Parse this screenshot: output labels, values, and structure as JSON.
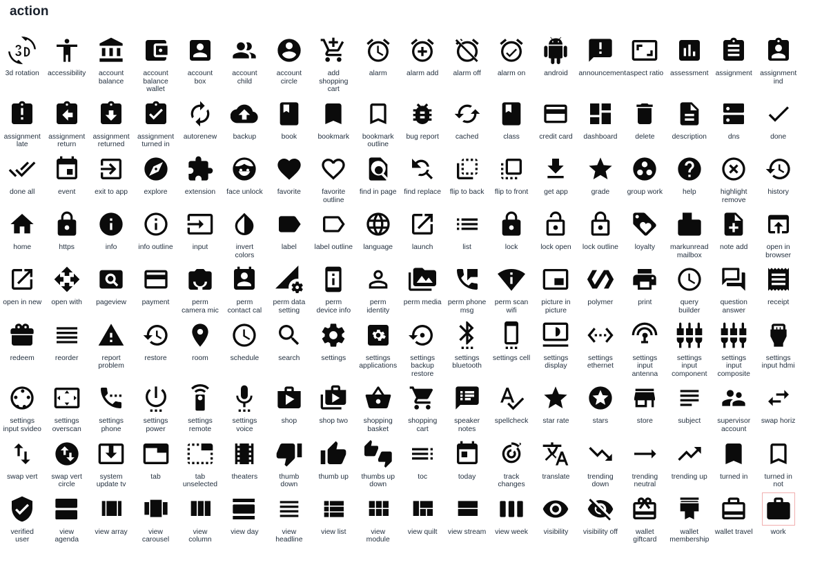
{
  "page": {
    "title": "action"
  },
  "theme": {
    "background": "#ffffff",
    "icon_color": "#0b0b0b",
    "label_color": "#23303f",
    "title_color": "#18202b",
    "highlight_outline": "#f0aaaa"
  },
  "grid": {
    "columns": 18,
    "rows": 8,
    "total_icons": 144
  },
  "icons": [
    {
      "label": "3d rotation",
      "glyph": "3d-rotation-icon"
    },
    {
      "label": "accessibility",
      "glyph": "accessibility-icon"
    },
    {
      "label": "account\nbalance",
      "glyph": "account-balance-icon"
    },
    {
      "label": "account\nbalance\nwallet",
      "glyph": "account-balance-wallet-icon"
    },
    {
      "label": "account\nbox",
      "glyph": "account-box-icon"
    },
    {
      "label": "account\nchild",
      "glyph": "account-child-icon"
    },
    {
      "label": "account\ncircle",
      "glyph": "account-circle-icon"
    },
    {
      "label": "add\nshopping\ncart",
      "glyph": "add-shopping-cart-icon"
    },
    {
      "label": "alarm",
      "glyph": "alarm-icon"
    },
    {
      "label": "alarm add",
      "glyph": "alarm-add-icon"
    },
    {
      "label": "alarm off",
      "glyph": "alarm-off-icon"
    },
    {
      "label": "alarm on",
      "glyph": "alarm-on-icon"
    },
    {
      "label": "android",
      "glyph": "android-icon"
    },
    {
      "label": "announcement",
      "glyph": "announcement-icon"
    },
    {
      "label": "aspect ratio",
      "glyph": "aspect-ratio-icon"
    },
    {
      "label": "assessment",
      "glyph": "assessment-icon"
    },
    {
      "label": "assignment",
      "glyph": "assignment-icon"
    },
    {
      "label": "assignment\nind",
      "glyph": "assignment-ind-icon"
    },
    {
      "label": "assignment\nlate",
      "glyph": "assignment-late-icon"
    },
    {
      "label": "assignment\nreturn",
      "glyph": "assignment-return-icon"
    },
    {
      "label": "assignment\nreturned",
      "glyph": "assignment-returned-icon"
    },
    {
      "label": "assignment\nturned in",
      "glyph": "assignment-turned-in-icon"
    },
    {
      "label": "autorenew",
      "glyph": "autorenew-icon"
    },
    {
      "label": "backup",
      "glyph": "backup-icon"
    },
    {
      "label": "book",
      "glyph": "book-icon"
    },
    {
      "label": "bookmark",
      "glyph": "bookmark-icon"
    },
    {
      "label": "bookmark\noutline",
      "glyph": "bookmark-outline-icon"
    },
    {
      "label": "bug report",
      "glyph": "bug-report-icon"
    },
    {
      "label": "cached",
      "glyph": "cached-icon"
    },
    {
      "label": "class",
      "glyph": "class-icon"
    },
    {
      "label": "credit card",
      "glyph": "credit-card-icon"
    },
    {
      "label": "dashboard",
      "glyph": "dashboard-icon"
    },
    {
      "label": "delete",
      "glyph": "delete-icon"
    },
    {
      "label": "description",
      "glyph": "description-icon"
    },
    {
      "label": "dns",
      "glyph": "dns-icon"
    },
    {
      "label": "done",
      "glyph": "done-icon"
    },
    {
      "label": "done all",
      "glyph": "done-all-icon"
    },
    {
      "label": "event",
      "glyph": "event-icon"
    },
    {
      "label": "exit to app",
      "glyph": "exit-to-app-icon"
    },
    {
      "label": "explore",
      "glyph": "explore-icon"
    },
    {
      "label": "extension",
      "glyph": "extension-icon"
    },
    {
      "label": "face unlock",
      "glyph": "face-unlock-icon"
    },
    {
      "label": "favorite",
      "glyph": "favorite-icon"
    },
    {
      "label": "favorite\noutline",
      "glyph": "favorite-outline-icon"
    },
    {
      "label": "find in page",
      "glyph": "find-in-page-icon"
    },
    {
      "label": "find replace",
      "glyph": "find-replace-icon"
    },
    {
      "label": "flip to back",
      "glyph": "flip-to-back-icon"
    },
    {
      "label": "flip to front",
      "glyph": "flip-to-front-icon"
    },
    {
      "label": "get app",
      "glyph": "get-app-icon"
    },
    {
      "label": "grade",
      "glyph": "grade-icon"
    },
    {
      "label": "group work",
      "glyph": "group-work-icon"
    },
    {
      "label": "help",
      "glyph": "help-icon"
    },
    {
      "label": "highlight\nremove",
      "glyph": "highlight-remove-icon"
    },
    {
      "label": "history",
      "glyph": "history-icon"
    },
    {
      "label": "home",
      "glyph": "home-icon"
    },
    {
      "label": "https",
      "glyph": "https-icon"
    },
    {
      "label": "info",
      "glyph": "info-icon"
    },
    {
      "label": "info outline",
      "glyph": "info-outline-icon"
    },
    {
      "label": "input",
      "glyph": "input-icon"
    },
    {
      "label": "invert\ncolors",
      "glyph": "invert-colors-icon"
    },
    {
      "label": "label",
      "glyph": "label-icon"
    },
    {
      "label": "label outline",
      "glyph": "label-outline-icon"
    },
    {
      "label": "language",
      "glyph": "language-icon"
    },
    {
      "label": "launch",
      "glyph": "launch-icon"
    },
    {
      "label": "list",
      "glyph": "list-icon"
    },
    {
      "label": "lock",
      "glyph": "lock-icon"
    },
    {
      "label": "lock open",
      "glyph": "lock-open-icon"
    },
    {
      "label": "lock outline",
      "glyph": "lock-outline-icon"
    },
    {
      "label": "loyalty",
      "glyph": "loyalty-icon"
    },
    {
      "label": "markunread\nmailbox",
      "glyph": "markunread-mailbox-icon"
    },
    {
      "label": "note add",
      "glyph": "note-add-icon"
    },
    {
      "label": "open in\nbrowser",
      "glyph": "open-in-browser-icon"
    },
    {
      "label": "open in new",
      "glyph": "open-in-new-icon"
    },
    {
      "label": "open with",
      "glyph": "open-with-icon"
    },
    {
      "label": "pageview",
      "glyph": "pageview-icon"
    },
    {
      "label": "payment",
      "glyph": "payment-icon"
    },
    {
      "label": "perm\ncamera mic",
      "glyph": "perm-camera-mic-icon"
    },
    {
      "label": "perm\ncontact cal",
      "glyph": "perm-contact-cal-icon"
    },
    {
      "label": "perm data\nsetting",
      "glyph": "perm-data-setting-icon"
    },
    {
      "label": "perm\ndevice info",
      "glyph": "perm-device-info-icon"
    },
    {
      "label": "perm\nidentity",
      "glyph": "perm-identity-icon"
    },
    {
      "label": "perm media",
      "glyph": "perm-media-icon"
    },
    {
      "label": "perm phone\nmsg",
      "glyph": "perm-phone-msg-icon"
    },
    {
      "label": "perm scan\nwifi",
      "glyph": "perm-scan-wifi-icon"
    },
    {
      "label": "picture in\npicture",
      "glyph": "picture-in-picture-icon"
    },
    {
      "label": "polymer",
      "glyph": "polymer-icon"
    },
    {
      "label": "print",
      "glyph": "print-icon"
    },
    {
      "label": "query\nbuilder",
      "glyph": "query-builder-icon"
    },
    {
      "label": "question\nanswer",
      "glyph": "question-answer-icon"
    },
    {
      "label": "receipt",
      "glyph": "receipt-icon"
    },
    {
      "label": "redeem",
      "glyph": "redeem-icon"
    },
    {
      "label": "reorder",
      "glyph": "reorder-icon"
    },
    {
      "label": "report\nproblem",
      "glyph": "report-problem-icon"
    },
    {
      "label": "restore",
      "glyph": "restore-icon"
    },
    {
      "label": "room",
      "glyph": "room-icon"
    },
    {
      "label": "schedule",
      "glyph": "schedule-icon"
    },
    {
      "label": "search",
      "glyph": "search-icon"
    },
    {
      "label": "settings",
      "glyph": "settings-icon"
    },
    {
      "label": "settings\napplications",
      "glyph": "settings-applications-icon"
    },
    {
      "label": "settings\nbackup\nrestore",
      "glyph": "settings-backup-restore-icon"
    },
    {
      "label": "settings\nbluetooth",
      "glyph": "settings-bluetooth-icon"
    },
    {
      "label": "settings cell",
      "glyph": "settings-cell-icon"
    },
    {
      "label": "settings\ndisplay",
      "glyph": "settings-display-icon"
    },
    {
      "label": "settings\nethernet",
      "glyph": "settings-ethernet-icon"
    },
    {
      "label": "settings\ninput\nantenna",
      "glyph": "settings-input-antenna-icon"
    },
    {
      "label": "settings\ninput\ncomponent",
      "glyph": "settings-input-component-icon"
    },
    {
      "label": "settings\ninput\ncomposite",
      "glyph": "settings-input-composite-icon"
    },
    {
      "label": "settings\ninput hdmi",
      "glyph": "settings-input-hdmi-icon"
    },
    {
      "label": "settings\ninput svideo",
      "glyph": "settings-input-svideo-icon"
    },
    {
      "label": "settings\noverscan",
      "glyph": "settings-overscan-icon"
    },
    {
      "label": "settings\nphone",
      "glyph": "settings-phone-icon"
    },
    {
      "label": "settings\npower",
      "glyph": "settings-power-icon"
    },
    {
      "label": "settings\nremote",
      "glyph": "settings-remote-icon"
    },
    {
      "label": "settings\nvoice",
      "glyph": "settings-voice-icon"
    },
    {
      "label": "shop",
      "glyph": "shop-icon"
    },
    {
      "label": "shop two",
      "glyph": "shop-two-icon"
    },
    {
      "label": "shopping\nbasket",
      "glyph": "shopping-basket-icon"
    },
    {
      "label": "shopping\ncart",
      "glyph": "shopping-cart-icon"
    },
    {
      "label": "speaker\nnotes",
      "glyph": "speaker-notes-icon"
    },
    {
      "label": "spellcheck",
      "glyph": "spellcheck-icon"
    },
    {
      "label": "star rate",
      "glyph": "star-rate-icon"
    },
    {
      "label": "stars",
      "glyph": "stars-icon"
    },
    {
      "label": "store",
      "glyph": "store-icon"
    },
    {
      "label": "subject",
      "glyph": "subject-icon"
    },
    {
      "label": "supervisor\naccount",
      "glyph": "supervisor-account-icon"
    },
    {
      "label": "swap horiz",
      "glyph": "swap-horiz-icon"
    },
    {
      "label": "swap vert",
      "glyph": "swap-vert-icon"
    },
    {
      "label": "swap vert\ncircle",
      "glyph": "swap-vert-circle-icon"
    },
    {
      "label": "system\nupdate tv",
      "glyph": "system-update-tv-icon"
    },
    {
      "label": "tab",
      "glyph": "tab-icon"
    },
    {
      "label": "tab\nunselected",
      "glyph": "tab-unselected-icon"
    },
    {
      "label": "theaters",
      "glyph": "theaters-icon"
    },
    {
      "label": "thumb\ndown",
      "glyph": "thumb-down-icon"
    },
    {
      "label": "thumb up",
      "glyph": "thumb-up-icon"
    },
    {
      "label": "thumbs up\ndown",
      "glyph": "thumbs-up-down-icon"
    },
    {
      "label": "toc",
      "glyph": "toc-icon"
    },
    {
      "label": "today",
      "glyph": "today-icon"
    },
    {
      "label": "track\nchanges",
      "glyph": "track-changes-icon"
    },
    {
      "label": "translate",
      "glyph": "translate-icon"
    },
    {
      "label": "trending\ndown",
      "glyph": "trending-down-icon"
    },
    {
      "label": "trending\nneutral",
      "glyph": "trending-neutral-icon"
    },
    {
      "label": "trending up",
      "glyph": "trending-up-icon"
    },
    {
      "label": "turned in",
      "glyph": "turned-in-icon"
    },
    {
      "label": "turned in\nnot",
      "glyph": "turned-in-not-icon"
    },
    {
      "label": "verified\nuser",
      "glyph": "verified-user-icon"
    },
    {
      "label": "view\nagenda",
      "glyph": "view-agenda-icon"
    },
    {
      "label": "view array",
      "glyph": "view-array-icon"
    },
    {
      "label": "view\ncarousel",
      "glyph": "view-carousel-icon"
    },
    {
      "label": "view\ncolumn",
      "glyph": "view-column-icon"
    },
    {
      "label": "view day",
      "glyph": "view-day-icon"
    },
    {
      "label": "view\nheadline",
      "glyph": "view-headline-icon"
    },
    {
      "label": "view list",
      "glyph": "view-list-icon"
    },
    {
      "label": "view\nmodule",
      "glyph": "view-module-icon"
    },
    {
      "label": "view quilt",
      "glyph": "view-quilt-icon"
    },
    {
      "label": "view stream",
      "glyph": "view-stream-icon"
    },
    {
      "label": "view week",
      "glyph": "view-week-icon"
    },
    {
      "label": "visibility",
      "glyph": "visibility-icon"
    },
    {
      "label": "visibility off",
      "glyph": "visibility-off-icon"
    },
    {
      "label": "wallet\ngiftcard",
      "glyph": "wallet-giftcard-icon"
    },
    {
      "label": "wallet\nmembership",
      "glyph": "wallet-membership-icon"
    },
    {
      "label": "wallet travel",
      "glyph": "wallet-travel-icon"
    },
    {
      "label": "work",
      "glyph": "work-icon",
      "highlighted": true
    }
  ]
}
